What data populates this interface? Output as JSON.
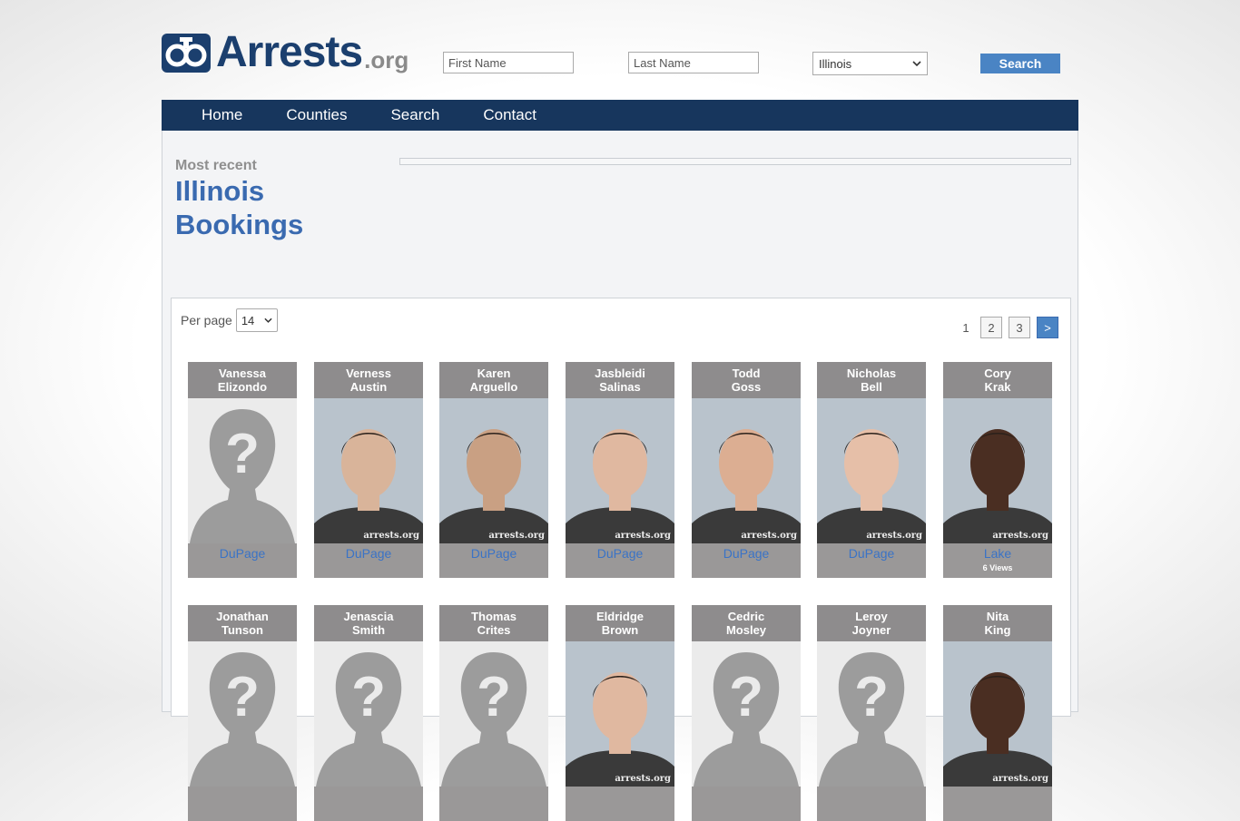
{
  "site": {
    "logo_text": "Arrests",
    "logo_suffix": ".org"
  },
  "search": {
    "first_name_placeholder": "First Name",
    "last_name_placeholder": "Last Name",
    "state_value": "Illinois",
    "button_label": "Search"
  },
  "nav": {
    "home": "Home",
    "counties": "Counties",
    "search": "Search",
    "contact": "Contact"
  },
  "heading": {
    "kicker": "Most recent",
    "title_line1": "Illinois",
    "title_line2": "Bookings"
  },
  "list": {
    "per_page_label": "Per page",
    "per_page_value": "14"
  },
  "pagination": {
    "current": "1",
    "pages": [
      "2",
      "3"
    ],
    "next": ">"
  },
  "watermark": "arrests.org",
  "bookings": [
    {
      "first": "Vanessa",
      "last": "Elizondo",
      "county": "DuPage",
      "views": "",
      "photo": "placeholder-icon"
    },
    {
      "first": "Verness",
      "last": "Austin",
      "county": "DuPage",
      "views": "",
      "photo": "mugshot"
    },
    {
      "first": "Karen",
      "last": "Arguello",
      "county": "DuPage",
      "views": "",
      "photo": "mugshot"
    },
    {
      "first": "Jasbleidi",
      "last": "Salinas",
      "county": "DuPage",
      "views": "",
      "photo": "mugshot"
    },
    {
      "first": "Todd",
      "last": "Goss",
      "county": "DuPage",
      "views": "",
      "photo": "mugshot"
    },
    {
      "first": "Nicholas",
      "last": "Bell",
      "county": "DuPage",
      "views": "",
      "photo": "mugshot"
    },
    {
      "first": "Cory",
      "last": "Krak",
      "county": "Lake",
      "views": "6 Views",
      "photo": "mugshot"
    },
    {
      "first": "Jonathan",
      "last": "Tunson",
      "county": "",
      "views": "",
      "photo": "placeholder-icon"
    },
    {
      "first": "Jenascia",
      "last": "Smith",
      "county": "",
      "views": "",
      "photo": "placeholder-icon"
    },
    {
      "first": "Thomas",
      "last": "Crites",
      "county": "",
      "views": "",
      "photo": "placeholder-icon"
    },
    {
      "first": "Eldridge",
      "last": "Brown",
      "county": "",
      "views": "",
      "photo": "mugshot"
    },
    {
      "first": "Cedric",
      "last": "Mosley",
      "county": "",
      "views": "",
      "photo": "placeholder-icon"
    },
    {
      "first": "Leroy",
      "last": "Joyner",
      "county": "",
      "views": "",
      "photo": "placeholder-icon"
    },
    {
      "first": "Nita",
      "last": "King",
      "county": "",
      "views": "",
      "photo": "mugshot"
    }
  ]
}
